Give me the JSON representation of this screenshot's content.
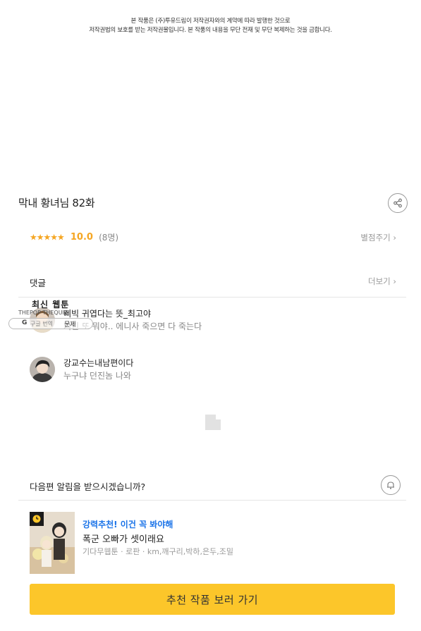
{
  "notice": {
    "line1": "본 작품은 (주)투유드림이 저작권자와의 계약에 따라 발행한 것으로",
    "line2": "저작권법의 보호를 받는 저작권물입니다. 본 작품의 내용을 무단 전재 및 무단 복제하는 것을 금합니다."
  },
  "episode": {
    "title": "막내 황녀님 82화",
    "share_icon": "share-icon"
  },
  "rating": {
    "stars": "★★★★★",
    "score": "10.0",
    "count": "(8명)",
    "rate_link": "별점주기 ›"
  },
  "comments": {
    "label": "댓글",
    "more_link": "더보기 ›",
    "items": [
      {
        "user": "삐빅 귀엽다는 뜻_최고야",
        "text": "거긴 또 뭐야.. 에니사 죽으면 다 죽는다"
      },
      {
        "user": "강교수는내남편이다",
        "text": "누구냐 던진놈 나와"
      }
    ]
  },
  "overlay": {
    "title": "최신 웹툰",
    "small_text": "THEPOP THEQUIZ",
    "google": "G",
    "translate": "구글 번역",
    "quiz": "문제"
  },
  "notify": {
    "text": "다음편 알림을 받으시겠습니까?",
    "bell_icon": "bell-icon"
  },
  "recommend": {
    "tag": "강력추천! 이건 꼭 봐야해",
    "title": "폭군 오빠가 셋이래요",
    "meta": "기다무웹툰 · 로판 · km,깨구리,박하,은두,조밀",
    "badge_icon": "clock-icon"
  },
  "cta": {
    "label": "추천 작품 보러 가기"
  },
  "colors": {
    "accent": "#fcc62a",
    "star": "#f5a623",
    "link_blue": "#1a73e8"
  }
}
